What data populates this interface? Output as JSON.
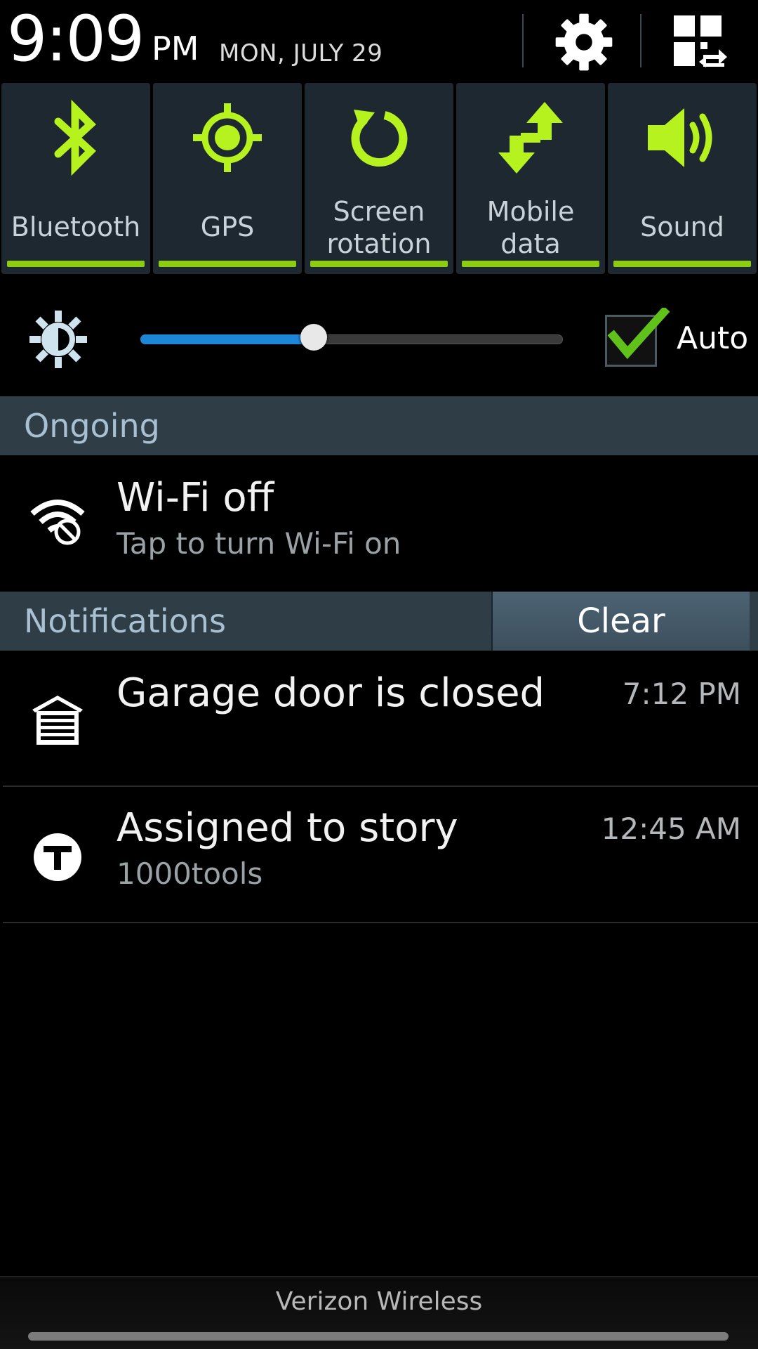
{
  "header": {
    "time": "9:09",
    "ampm": "PM",
    "date": "MON, JULY 29",
    "settings_icon": "gear-icon",
    "edit_icon": "grid-swap-icon"
  },
  "toggles": [
    {
      "label_line1": "Bluetooth",
      "label_line2": "",
      "icon": "bluetooth-icon",
      "active": true
    },
    {
      "label_line1": "GPS",
      "label_line2": "",
      "icon": "gps-icon",
      "active": true
    },
    {
      "label_line1": "Screen",
      "label_line2": "rotation",
      "icon": "rotation-icon",
      "active": true
    },
    {
      "label_line1": "Mobile",
      "label_line2": "data",
      "icon": "mobile-data-icon",
      "active": true
    },
    {
      "label_line1": "Sound",
      "label_line2": "",
      "icon": "speaker-icon",
      "active": true
    }
  ],
  "brightness": {
    "level": 0.41,
    "auto_checked": true,
    "auto_label": "Auto"
  },
  "ongoing": {
    "title": "Ongoing",
    "items": [
      {
        "title": "Wi-Fi off",
        "subtitle": "Tap to turn Wi-Fi on",
        "icon": "wifi-off-icon"
      }
    ]
  },
  "notifications": {
    "title": "Notifications",
    "clear_label": "Clear",
    "items": [
      {
        "title": "Garage door is closed",
        "subtitle": "",
        "time": "7:12 PM",
        "icon": "garage-icon"
      },
      {
        "title": "Assigned to story",
        "subtitle": "1000tools",
        "time": "12:45 AM",
        "icon": "tracker-t-icon"
      }
    ]
  },
  "footer": {
    "carrier": "Verizon Wireless"
  },
  "colors": {
    "accent_green": "#8ccd10",
    "icon_green": "#b6f21e",
    "slider_blue": "#1e86d6",
    "section_bg": "#2f3d47",
    "toggle_bg": "#1d2830"
  }
}
